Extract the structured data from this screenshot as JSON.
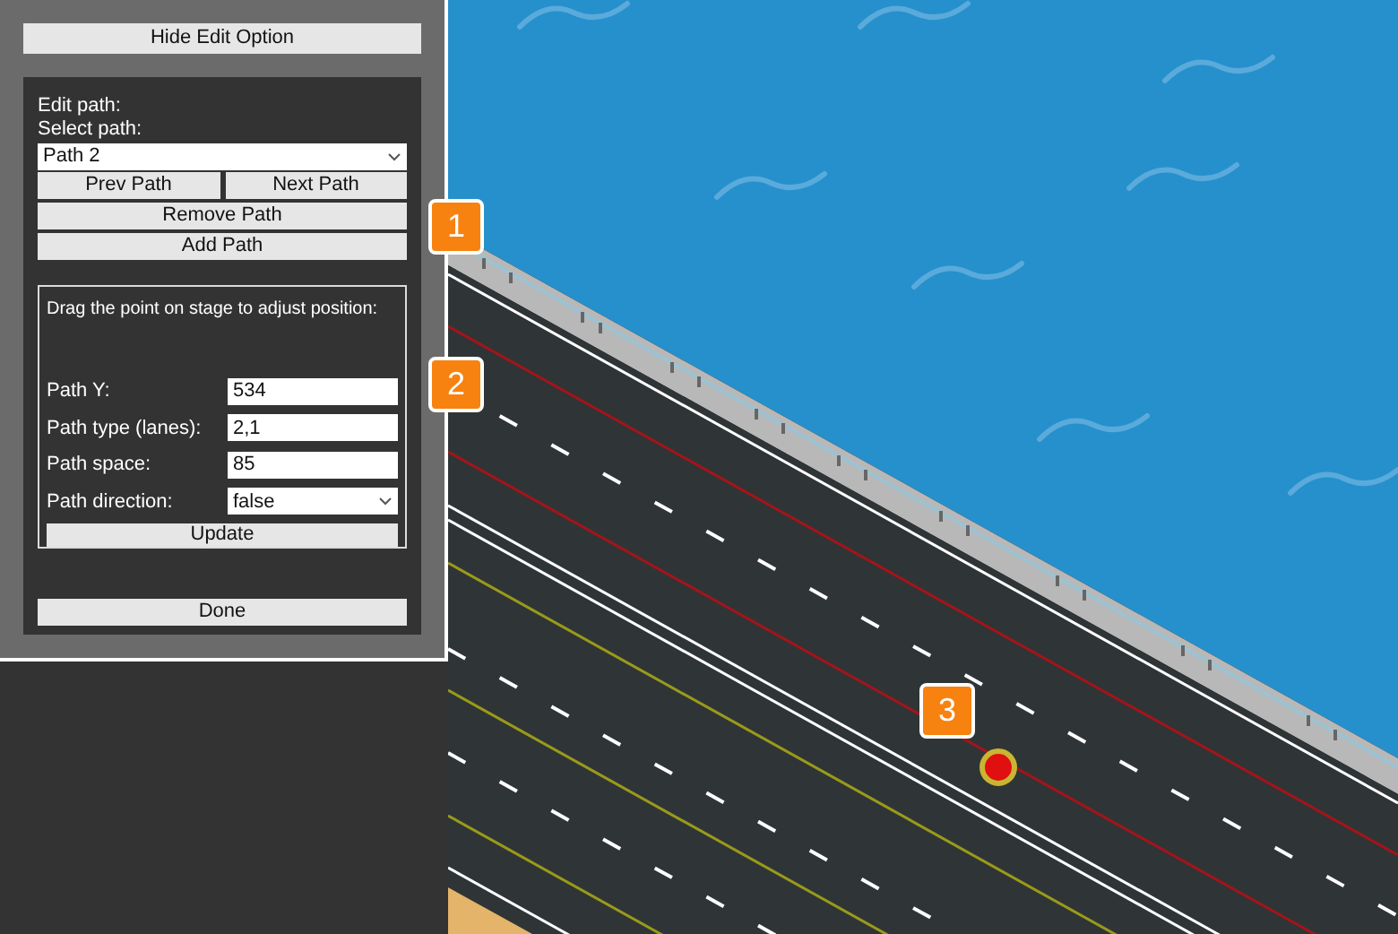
{
  "panel": {
    "toggle_button": "Hide Edit Option",
    "edit_label": "Edit path:",
    "select_label": "Select path:",
    "path_select": {
      "value": "Path 2"
    },
    "nav_buttons": [
      "Prev Path",
      "Next Path"
    ],
    "buttons": [
      "Remove Path",
      "Add Path"
    ],
    "position_box": {
      "hint": "Drag the point on stage to adjust position:",
      "fields": [
        {
          "label": "Path Y:",
          "kind": "text",
          "value": "534"
        },
        {
          "label": "Path type (lanes):",
          "kind": "text",
          "value": "2,1"
        },
        {
          "label": "Path space:",
          "kind": "text",
          "value": "85"
        },
        {
          "label": "Path direction:",
          "kind": "select",
          "value": "false"
        }
      ],
      "update_button": "Update"
    },
    "done_button": "Done"
  },
  "callouts": [
    "1",
    "2",
    "3"
  ]
}
